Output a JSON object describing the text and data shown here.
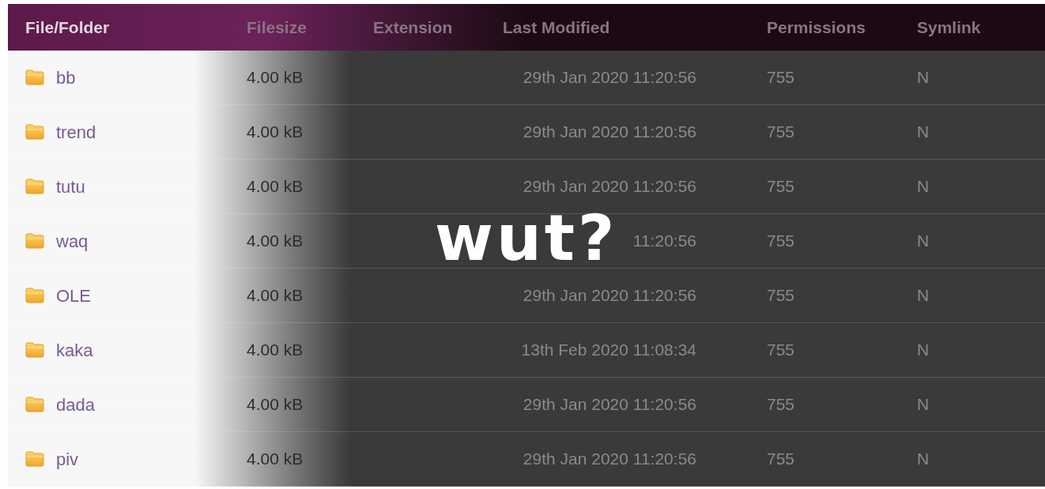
{
  "table": {
    "columns": [
      "File/Folder",
      "Filesize",
      "Extension",
      "Last Modified",
      "Permissions",
      "Symlink"
    ],
    "rows": [
      {
        "name": "bb",
        "filesize": "4.00 kB",
        "last_modified": "29th Jan 2020 11:20:56",
        "permissions": "755",
        "symlink": "N"
      },
      {
        "name": "trend",
        "filesize": "4.00 kB",
        "last_modified": "29th Jan 2020 11:20:56",
        "permissions": "755",
        "symlink": "N"
      },
      {
        "name": "tutu",
        "filesize": "4.00 kB",
        "last_modified": "29th Jan 2020 11:20:56",
        "permissions": "755",
        "symlink": "N"
      },
      {
        "name": "waq",
        "filesize": "4.00 kB",
        "last_modified": "11:20:56",
        "permissions": "755",
        "symlink": "N"
      },
      {
        "name": "OLE",
        "filesize": "4.00 kB",
        "last_modified": "29th Jan 2020 11:20:56",
        "permissions": "755",
        "symlink": "N"
      },
      {
        "name": "kaka",
        "filesize": "4.00 kB",
        "last_modified": "13th Feb 2020 11:08:34",
        "permissions": "755",
        "symlink": "N"
      },
      {
        "name": "dada",
        "filesize": "4.00 kB",
        "last_modified": "29th Jan 2020 11:20:56",
        "permissions": "755",
        "symlink": "N"
      },
      {
        "name": "piv",
        "filesize": "4.00 kB",
        "last_modified": "29th Jan 2020 11:20:56",
        "permissions": "755",
        "symlink": "N"
      }
    ]
  },
  "overlay": {
    "caption": "wut?"
  }
}
